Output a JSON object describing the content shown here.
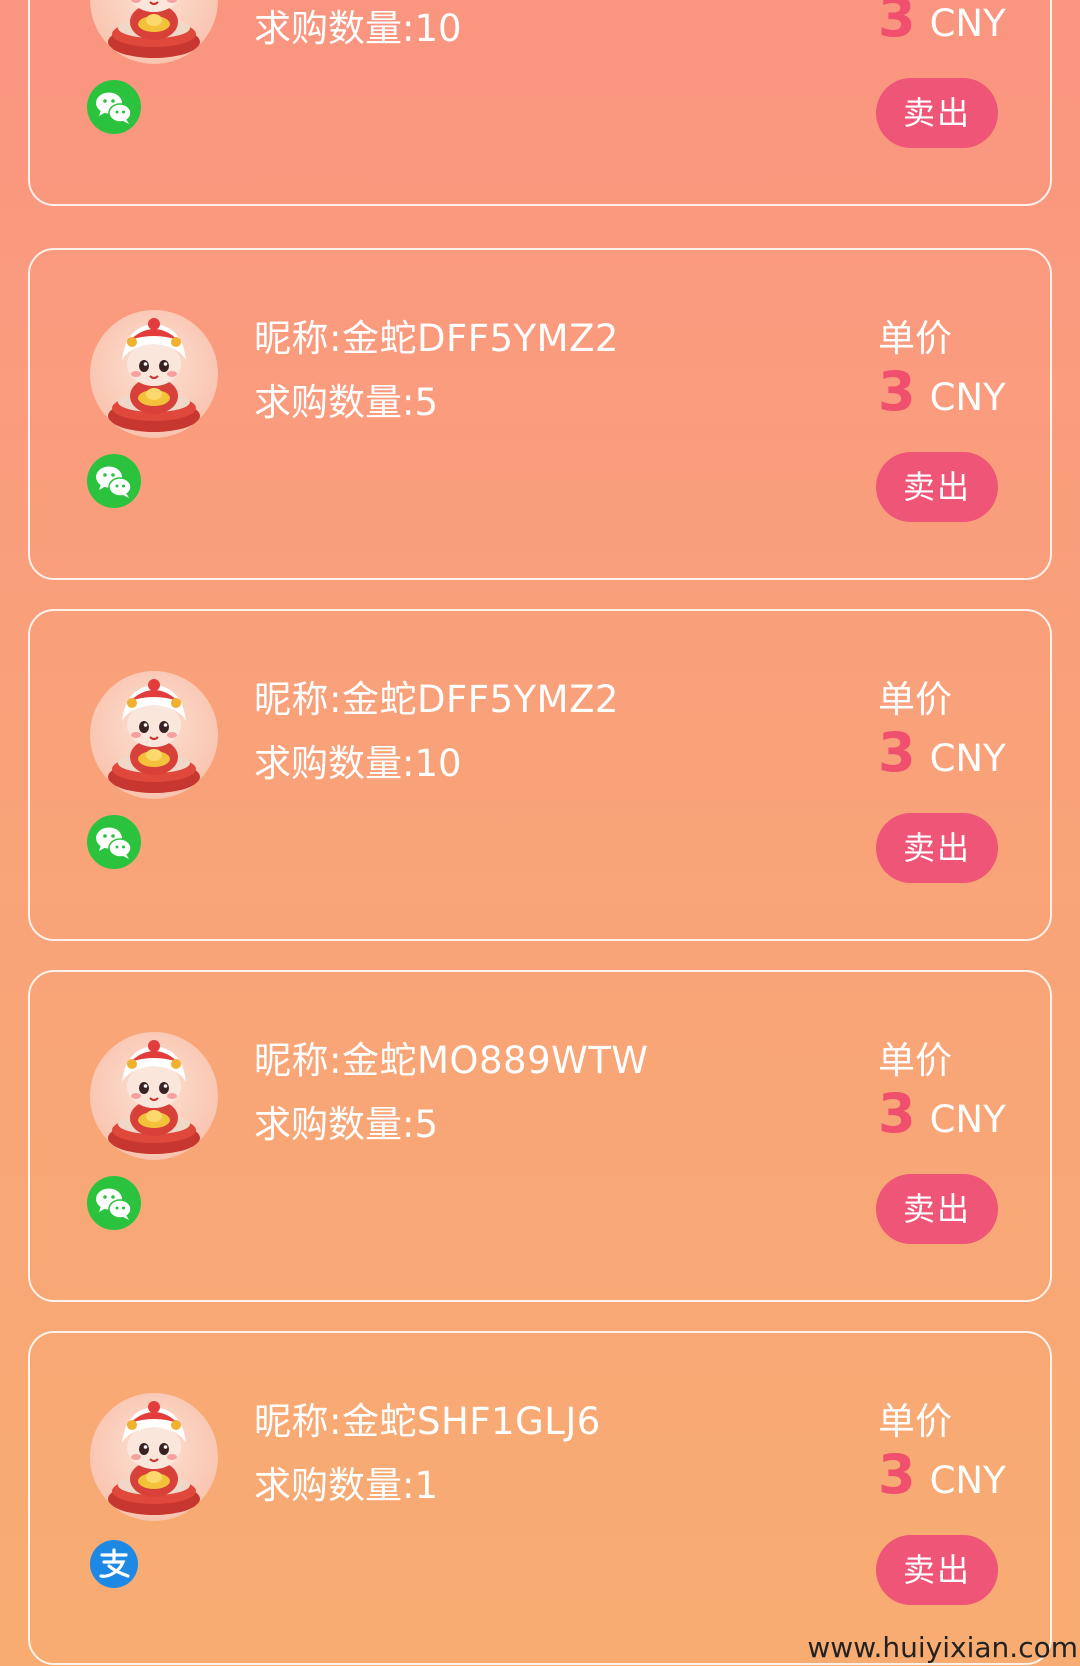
{
  "colors": {
    "background_top": "#fa9580",
    "background_bottom": "#f8ac72",
    "price_accent": "#f0506e",
    "sell_button": "#ee5577",
    "wechat_green": "#2bc33d",
    "alipay_blue": "#1e88e5"
  },
  "orders": [
    {
      "nickname": "",
      "quantity": "求购数量:10",
      "price_label": "",
      "price_value": "3",
      "price_unit": "CNY",
      "sell_label": "卖出",
      "payment_icon": "wechat-pay-icon"
    },
    {
      "nickname": "昵称:金蛇DFF5YMZ2",
      "quantity": "求购数量:5",
      "price_label": "单价",
      "price_value": "3",
      "price_unit": "CNY",
      "sell_label": "卖出",
      "payment_icon": "wechat-pay-icon"
    },
    {
      "nickname": "昵称:金蛇DFF5YMZ2",
      "quantity": "求购数量:10",
      "price_label": "单价",
      "price_value": "3",
      "price_unit": "CNY",
      "sell_label": "卖出",
      "payment_icon": "wechat-pay-icon"
    },
    {
      "nickname": "昵称:金蛇MO889WTW",
      "quantity": "求购数量:5",
      "price_label": "单价",
      "price_value": "3",
      "price_unit": "CNY",
      "sell_label": "卖出",
      "payment_icon": "wechat-pay-icon"
    },
    {
      "nickname": "昵称:金蛇SHF1GLJ6",
      "quantity": "求购数量:1",
      "price_label": "单价",
      "price_value": "3",
      "price_unit": "CNY",
      "sell_label": "卖出",
      "payment_icon": "alipay-icon"
    }
  ],
  "watermark": "www.huiyixian.com"
}
